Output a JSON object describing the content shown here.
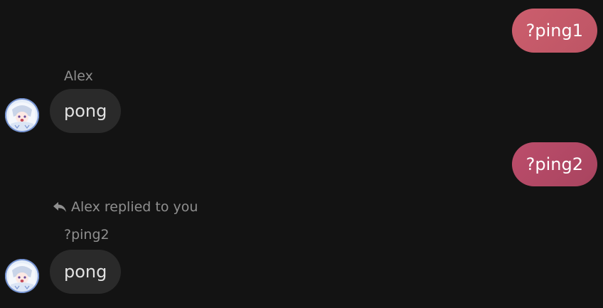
{
  "messages": {
    "out1": {
      "text": "?ping1"
    },
    "in1": {
      "sender": "Alex",
      "text": "pong"
    },
    "out2": {
      "text": "?ping2"
    },
    "in2": {
      "reply_notice": "Alex replied to you",
      "reply_preview": "?ping2",
      "text": "pong"
    }
  },
  "icons": {
    "reply": "reply-arrow-icon",
    "avatar": "anime-girl-avatar"
  },
  "colors": {
    "background": "#131313",
    "outgoing_bubble_1": "#c85b6b",
    "outgoing_bubble_2": "#b24865",
    "incoming_bubble": "#2a2a2a",
    "meta_text": "#8f8f8f"
  }
}
